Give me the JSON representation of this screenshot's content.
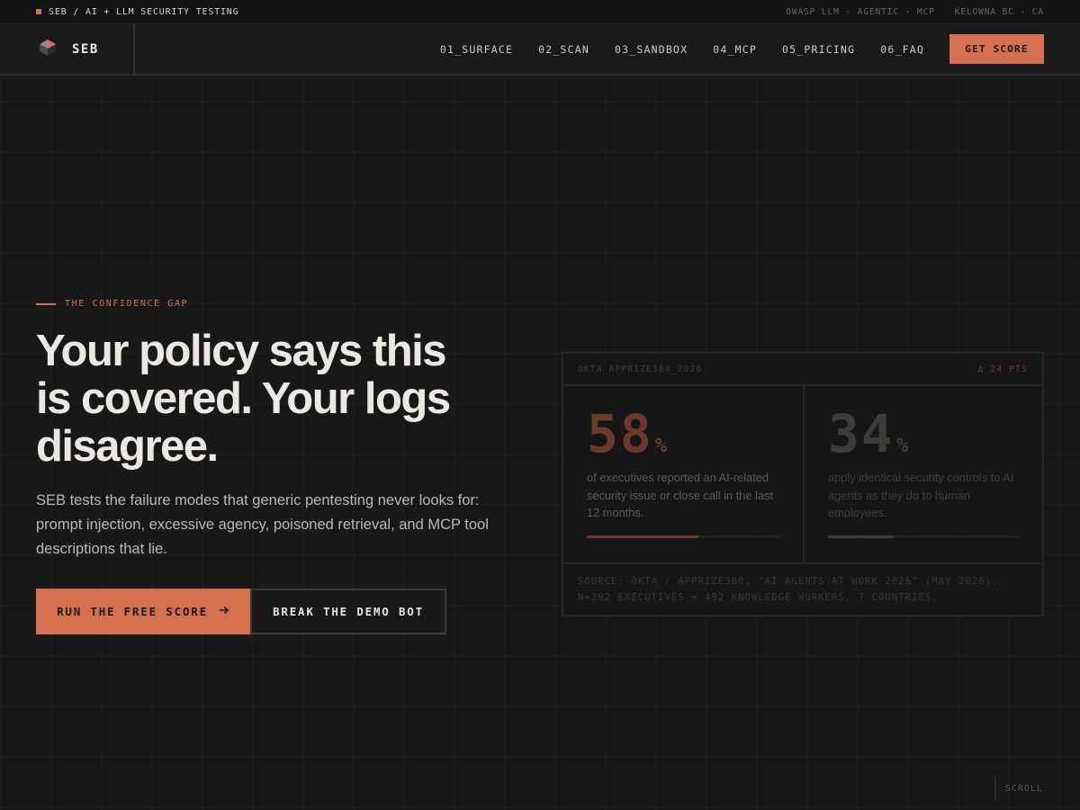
{
  "topbar": {
    "left_text": "SEB / AI + LLM SECURITY TESTING",
    "right_items": [
      "OWASP LLM · AGENTIC · MCP",
      "KELOWNA BC · CA"
    ]
  },
  "nav": {
    "brand": "SEB",
    "links": [
      "01_SURFACE",
      "02_SCAN",
      "03_SANDBOX",
      "04_MCP",
      "05_PRICING",
      "06_FAQ"
    ],
    "cta": "GET SCORE"
  },
  "hero": {
    "eyebrow": "THE CONFIDENCE GAP",
    "headline_lines": [
      "Your policy says this",
      "is covered. Your logs",
      "disagree."
    ],
    "subtext": "SEB tests the failure modes that generic pentesting never looks for: prompt injection, excessive agency, poisoned retrieval, and MCP tool descriptions that lie.",
    "primary_button": "RUN THE FREE SCORE",
    "secondary_button": "BREAK THE DEMO BOT"
  },
  "card": {
    "source_id": "OKTA_APPRIZE360_2026",
    "delta": "Δ 24 PTS",
    "stats": [
      {
        "value": "58",
        "unit": "%",
        "progress": 0.58,
        "description": "of executives reported an AI-related security issue or close call in the last 12 months."
      },
      {
        "value": "34",
        "unit": "%",
        "progress": 0.34,
        "description": "apply identical security controls to AI agents as they do to human employees."
      }
    ],
    "source_lines": [
      "SOURCE: OKTA / APPRIZE360, \"AI AGENTS AT WORK 2026\" (MAY 2026),",
      "N=292 EXECUTIVES + 492 KNOWLEDGE WORKERS, 7 COUNTRIES."
    ]
  },
  "scroll_label": "SCROLL",
  "colors": {
    "accent": "#d4704f",
    "background": "#181818"
  }
}
